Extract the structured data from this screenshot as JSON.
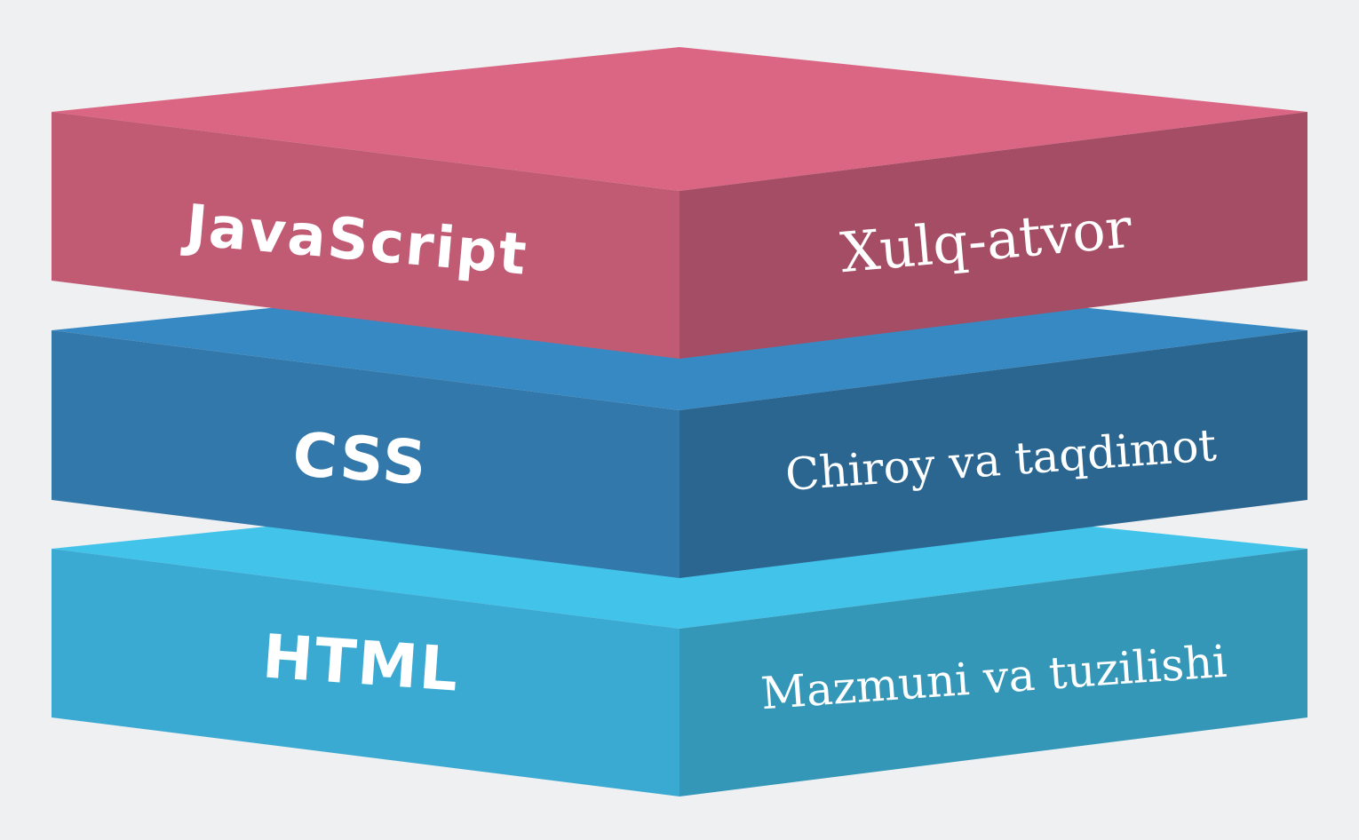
{
  "layers": [
    {
      "id": "javascript",
      "name": "JavaScript",
      "description": "Xulq-atvor",
      "colors": {
        "top": "#db6684",
        "left": "#c15b74",
        "right": "#a54d65"
      }
    },
    {
      "id": "css",
      "name": "CSS",
      "description": "Chiroy va taqdimot",
      "colors": {
        "top": "#3789c3",
        "left": "#3278aa",
        "right": "#2b6691"
      }
    },
    {
      "id": "html",
      "name": "HTML",
      "description": "Mazmuni va tuzilishi",
      "colors": {
        "top": "#42c3ea",
        "left": "#3aaad3",
        "right": "#3497b8"
      }
    }
  ]
}
